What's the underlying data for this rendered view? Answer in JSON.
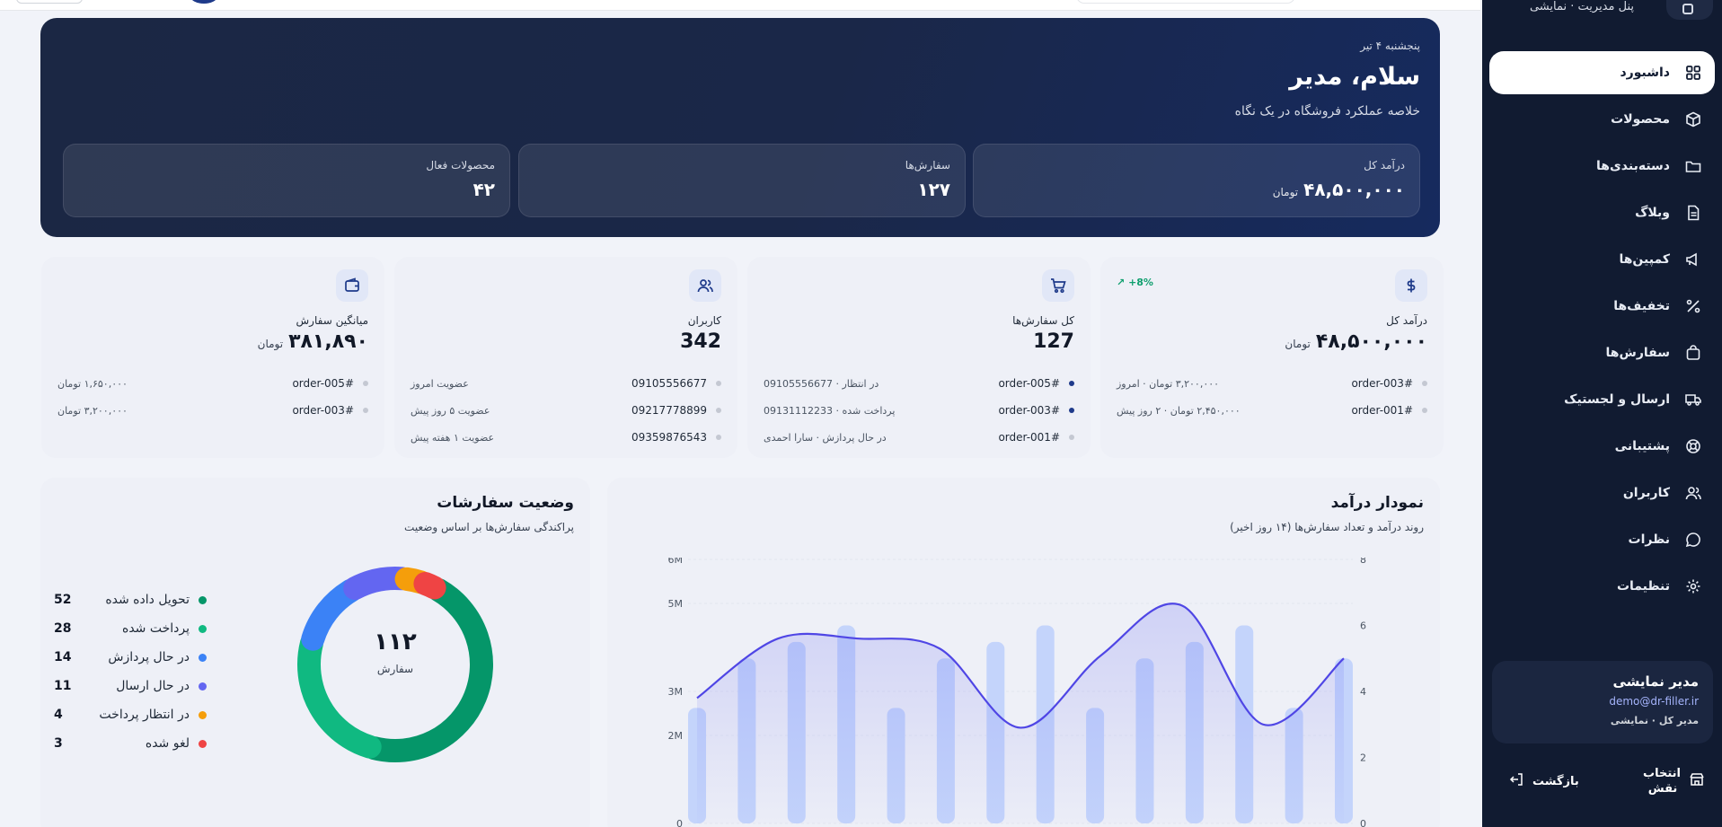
{
  "brand": {
    "title": "پنل مدیریت · نمایشی"
  },
  "sidebar": {
    "items": [
      {
        "label": "داشبورد",
        "icon": "dashboard-icon",
        "active": true
      },
      {
        "label": "محصولات",
        "icon": "box-icon"
      },
      {
        "label": "دسته‌بندی‌ها",
        "icon": "folder-icon"
      },
      {
        "label": "وبلاگ",
        "icon": "document-icon"
      },
      {
        "label": "کمپین‌ها",
        "icon": "megaphone-icon"
      },
      {
        "label": "تخفیف‌ها",
        "icon": "percent-icon"
      },
      {
        "label": "سفارش‌ها",
        "icon": "bag-icon"
      },
      {
        "label": "ارسال و لجستیک",
        "icon": "truck-icon"
      },
      {
        "label": "پشتیبانی",
        "icon": "lifebuoy-icon"
      },
      {
        "label": "کاربران",
        "icon": "users-icon"
      },
      {
        "label": "نظرات",
        "icon": "chat-icon"
      },
      {
        "label": "تنظیمات",
        "icon": "gear-icon"
      }
    ],
    "profile": {
      "name": "مدیر نمایشی",
      "email": "demo@dr-filler.ir",
      "role": "مدیر کل · نمایشی"
    },
    "switch_role": "انتخاب نقش",
    "back": "بازگشت"
  },
  "hero": {
    "date": "پنجشنبه ۴ تیر",
    "greeting": "سلام، مدیر",
    "subtitle": "خلاصه عملکرد فروشگاه در یک نگاه",
    "stats": [
      {
        "label": "درآمد کل",
        "value": "۴۸,۵۰۰,۰۰۰",
        "unit": "تومان"
      },
      {
        "label": "سفارش‌ها",
        "value": "۱۲۷"
      },
      {
        "label": "محصولات فعال",
        "value": "۴۲"
      }
    ]
  },
  "cards": [
    {
      "icon": "dollar-icon",
      "label": "درآمد کل",
      "value": "۴۸,۵۰۰,۰۰۰",
      "unit": "تومان",
      "trend": "+8%",
      "rows": [
        {
          "id": "#order-003",
          "info": "۳,۲۰۰,۰۰۰ تومان · امروز"
        },
        {
          "id": "#order-001",
          "info": "۲,۴۵۰,۰۰۰ تومان · ۲ روز پیش"
        }
      ]
    },
    {
      "icon": "cart-icon",
      "label": "کل سفارش‌ها",
      "value": "127",
      "rows": [
        {
          "id": "#order-005",
          "info": "در انتظار · 09105556677",
          "dot": "blue"
        },
        {
          "id": "#order-003",
          "info": "پرداخت شده · 09131112233",
          "dot": "blue"
        },
        {
          "id": "#order-001",
          "info": "در حال پردازش · سارا احمدی"
        }
      ]
    },
    {
      "icon": "users-icon",
      "label": "کاربران",
      "value": "342",
      "rows": [
        {
          "id": "09105556677",
          "info": "عضویت امروز"
        },
        {
          "id": "09217778899",
          "info": "عضویت ۵ روز پیش"
        },
        {
          "id": "09359876543",
          "info": "عضویت ۱ هفته پیش"
        }
      ]
    },
    {
      "icon": "wallet-icon",
      "label": "میانگین سفارش",
      "value": "۳۸۱,۸۹۰",
      "unit": "تومان",
      "rows": [
        {
          "id": "#order-005",
          "info": "۱,۶۵۰,۰۰۰ تومان"
        },
        {
          "id": "#order-003",
          "info": "۳,۲۰۰,۰۰۰ تومان"
        }
      ]
    }
  ],
  "revenue_panel": {
    "title": "نمودار درآمد",
    "subtitle": "روند درآمد و تعداد سفارش‌ها (۱۴ روز اخیر)"
  },
  "status_panel": {
    "title": "وضعیت سفارشات",
    "subtitle": "پراکندگی سفارش‌ها بر اساس وضعیت",
    "total": "۱۱۲",
    "total_label": "سفارش"
  },
  "chart_data": [
    {
      "type": "bar",
      "y_left_ticks": [
        "0",
        "2M",
        "3M",
        "5M",
        "6M"
      ],
      "y_right_ticks": [
        "0",
        "2",
        "4",
        "6",
        "8"
      ],
      "ylim_left": [
        0,
        6000000
      ],
      "ylim_right": [
        0,
        8
      ],
      "bars": [
        3.5,
        5,
        5.5,
        6,
        3.5,
        5,
        5.5,
        6,
        3.5,
        5,
        5.5,
        6,
        3.5,
        5
      ],
      "line": [
        3.8,
        5.6,
        5.6,
        5.3,
        2.9,
        5.1,
        6.6,
        3.0,
        5.0
      ]
    },
    {
      "type": "pie",
      "series": [
        {
          "name": "تحویل داده شده",
          "value": 52,
          "color": "#059669"
        },
        {
          "name": "پرداخت شده",
          "value": 28,
          "color": "#10b981"
        },
        {
          "name": "در حال پردازش",
          "value": 14,
          "color": "#3b82f6"
        },
        {
          "name": "در حال ارسال",
          "value": 11,
          "color": "#6366f1"
        },
        {
          "name": "در انتظار پرداخت",
          "value": 4,
          "color": "#f59e0b"
        },
        {
          "name": "لغو شده",
          "value": 3,
          "color": "#ef4444"
        }
      ]
    }
  ]
}
